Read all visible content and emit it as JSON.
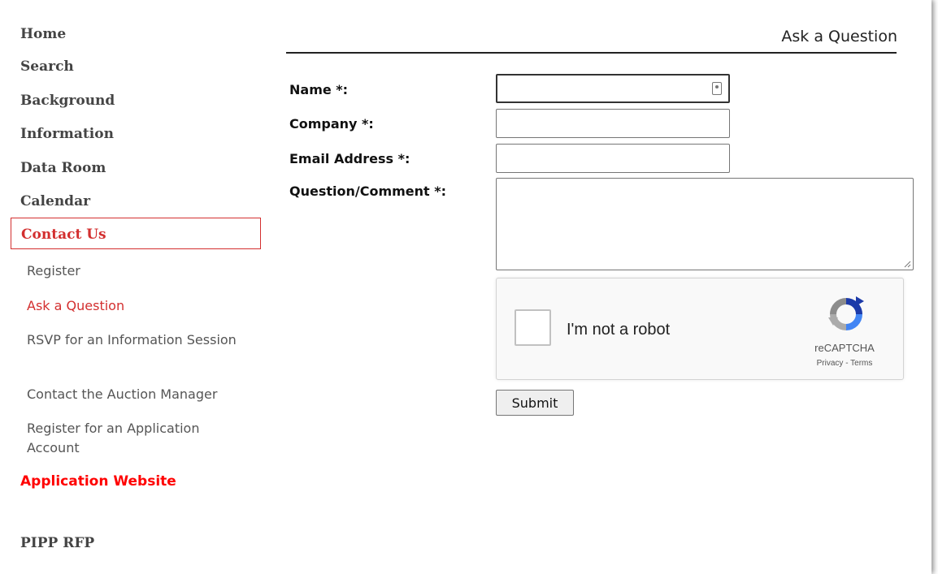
{
  "sidebar": {
    "main_items": [
      {
        "label": "Home"
      },
      {
        "label": "Search"
      },
      {
        "label": "Background"
      },
      {
        "label": "Information"
      },
      {
        "label": "Data Room"
      },
      {
        "label": "Calendar"
      }
    ],
    "active_item": {
      "label": "Contact Us",
      "color": "#d32f2f"
    },
    "sub_items": [
      {
        "label": "Register"
      },
      {
        "label": "Ask a Question",
        "current": true
      },
      {
        "label": "RSVP for an Information Session"
      },
      {
        "label": "Contact the Auction Manager"
      },
      {
        "label": "Register for an Application Account"
      }
    ],
    "application_website": {
      "label": "Application Website",
      "color": "#ff0000"
    },
    "pipp_rfp": {
      "label": "PIPP RFP"
    }
  },
  "main": {
    "title": "Ask a Question",
    "form": {
      "name_label": "Name *:",
      "name_value": "",
      "company_label": "Company *:",
      "company_value": "",
      "email_label": "Email Address *:",
      "email_value": "",
      "question_label": "Question/Comment *:",
      "question_value": ""
    },
    "captcha": {
      "checkbox_label": "I'm not a robot",
      "brand": "reCAPTCHA",
      "privacy": "Privacy",
      "separator": " - ",
      "terms": "Terms"
    },
    "submit_label": "Submit"
  },
  "colors": {
    "accent_red": "#d32f2f",
    "link_red": "#ff0000",
    "nav_gray": "#444444"
  },
  "icons": [
    "contact-card-icon",
    "recaptcha-logo-icon",
    "resize-handle-icon"
  ]
}
